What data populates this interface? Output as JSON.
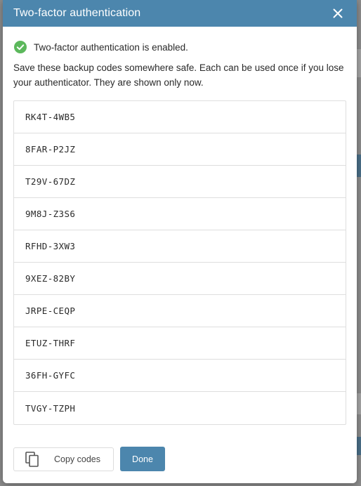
{
  "dialog": {
    "title": "Two-factor authentication",
    "close_icon": "close-icon",
    "status": {
      "icon": "check-circle-icon",
      "text": "Two-factor authentication is enabled."
    },
    "note": "Save these backup codes somewhere safe. Each can be used once if you lose your authenticator. They are shown only now.",
    "codes": [
      "RK4T-4WB5",
      "8FAR-P2JZ",
      "T29V-67DZ",
      "9M8J-Z3S6",
      "RFHD-3XW3",
      "9XEZ-82BY",
      "JRPE-CEQP",
      "ETUZ-THRF",
      "36FH-GYFC",
      "TVGY-TZPH"
    ],
    "copy_button": {
      "icon": "copy-icon",
      "label": "Copy codes"
    },
    "done_button": {
      "label": "Done"
    }
  },
  "colors": {
    "header": "#4c86ad",
    "primary_button": "#4c86ad",
    "success": "#5cb85c",
    "overlay": "#8c8c8c"
  }
}
